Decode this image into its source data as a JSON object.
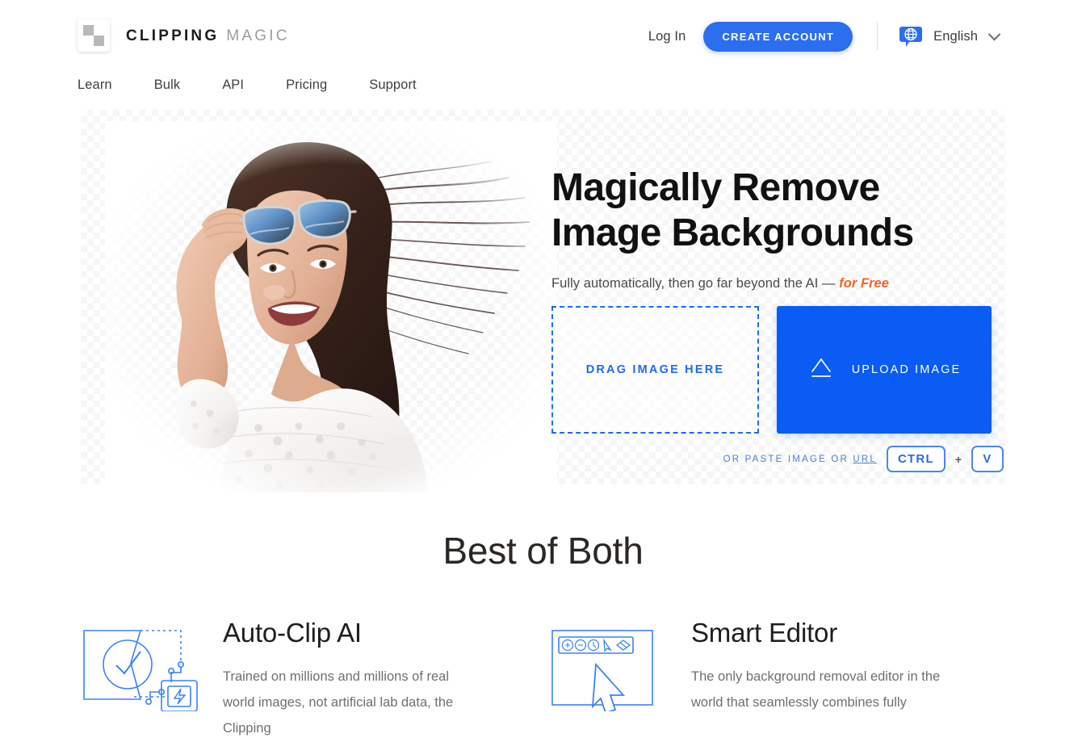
{
  "header": {
    "logo": {
      "icon": "checkerboard-logo-icon",
      "strong": "CLIPPING",
      "light": "MAGIC"
    },
    "login_label": "Log In",
    "create_account_label": "CREATE ACCOUNT",
    "language": {
      "icon": "globe-icon",
      "label": "English",
      "chevron": "chevron-down-icon"
    },
    "colors": {
      "cta_blue": "#2b6ef0",
      "globe_blue": "#2b6ef0"
    }
  },
  "nav": {
    "items": [
      {
        "label": "Learn"
      },
      {
        "label": "Bulk"
      },
      {
        "label": "API"
      },
      {
        "label": "Pricing"
      },
      {
        "label": "Support"
      }
    ]
  },
  "hero": {
    "photo_alt": "smiling-woman-with-sunglasses-photo",
    "headline_line1": "Magically Remove",
    "headline_line2": "Image Backgrounds",
    "subline_prefix": "Fully automatically, then go far beyond the AI — ",
    "subline_highlight": "for Free",
    "dropzone_label": "DRAG IMAGE HERE",
    "upload_label": "UPLOAD IMAGE",
    "upload_icon": "upload-arrow-icon",
    "paste_text_a": "OR PASTE IMAGE OR ",
    "paste_text_url": "URL",
    "key_ctrl": "CTRL",
    "key_plus": "+",
    "key_v": "V",
    "colors": {
      "upload_blue": "#0a5cf5",
      "dashed_blue": "#1f6af0",
      "free_orange": "#f26522"
    }
  },
  "best_of_both": {
    "title": "Best of Both",
    "features": [
      {
        "icon": "auto-clip-ai-icon",
        "title": "Auto-Clip AI",
        "desc": "Trained on millions and millions of real world images, not artificial lab data, the Clipping"
      },
      {
        "icon": "smart-editor-icon",
        "title": "Smart Editor",
        "desc": "The only background removal editor in the world that seamlessly combines fully"
      }
    ]
  }
}
